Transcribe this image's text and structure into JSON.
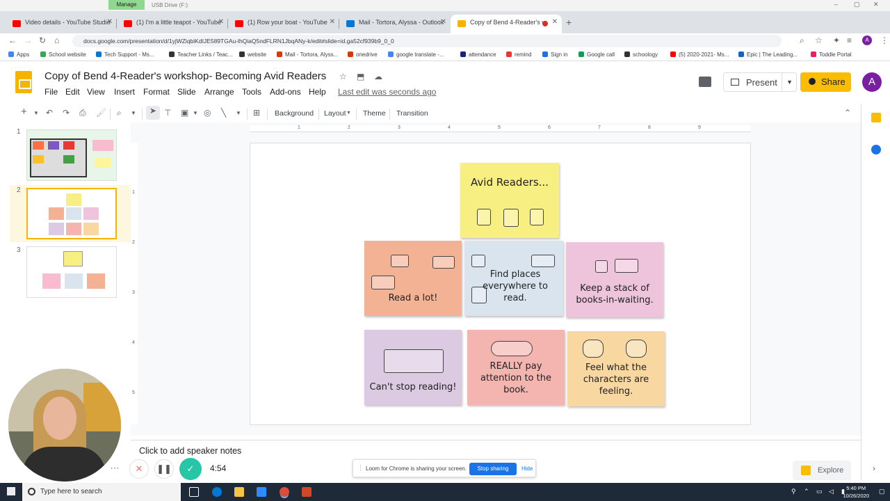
{
  "window": {
    "manage_label": "Manage",
    "drive_label": "USB Drive (F:)"
  },
  "tabs": [
    {
      "title": "Video details - YouTube Studio",
      "color": "#ff0000"
    },
    {
      "title": "(1) I'm a little teapot - YouTube",
      "color": "#ff0000"
    },
    {
      "title": "(1) Row your boat - YouTube",
      "color": "#ff0000"
    },
    {
      "title": "Mail - Tortora, Alyssa - Outlook",
      "color": "#0078d4"
    },
    {
      "title": "Copy of Bend 4-Reader's w",
      "color": "#f4b400"
    }
  ],
  "browser": {
    "url": "docs.google.com/presentation/d/1yjWZiqbiKdIJE589TGAu-lhQiaQ5ndFLRN1JbqANy-k/edit#slide=id.ga52cf939b9_0_0"
  },
  "bookmarks": [
    {
      "label": "Apps",
      "color": "#4285f4"
    },
    {
      "label": "School website",
      "color": "#34a853"
    },
    {
      "label": "Tech Support - Ms...",
      "color": "#0078d4"
    },
    {
      "label": "Teacher Links / Teac...",
      "color": "#333"
    },
    {
      "label": "website",
      "color": "#333"
    },
    {
      "label": "Mail - Tortora, Alyss...",
      "color": "#d83b01"
    },
    {
      "label": "onedrive",
      "color": "#d83b01"
    },
    {
      "label": "google translate -...",
      "color": "#4285f4"
    },
    {
      "label": "attendance",
      "color": "#1a237e"
    },
    {
      "label": "remind",
      "color": "#e53935"
    },
    {
      "label": "Sign in",
      "color": "#1a73e8"
    },
    {
      "label": "Google call",
      "color": "#0f9d58"
    },
    {
      "label": "schoology",
      "color": "#333"
    },
    {
      "label": "(5) 2020-2021- Ms...",
      "color": "#ff0000"
    },
    {
      "label": "Epic | The Leading...",
      "color": "#1565c0"
    },
    {
      "label": "Toddle Portal",
      "color": "#e91e63"
    }
  ],
  "doc": {
    "title": "Copy of Bend 4-Reader's workshop- Becoming Avid Readers",
    "last_edit": "Last edit was seconds ago",
    "menus": [
      "File",
      "Edit",
      "View",
      "Insert",
      "Format",
      "Slide",
      "Arrange",
      "Tools",
      "Add-ons",
      "Help"
    ],
    "present_label": "Present",
    "share_label": "Share",
    "avatar_letter": "A"
  },
  "toolbar": {
    "background": "Background",
    "layout": "Layout",
    "theme": "Theme",
    "transition": "Transition"
  },
  "ruler_ticks": [
    "1",
    "2",
    "3",
    "4",
    "5",
    "6",
    "7",
    "8",
    "9"
  ],
  "vruler_ticks": [
    "1",
    "2",
    "3",
    "4",
    "5"
  ],
  "filmstrip": {
    "numbers": [
      "1",
      "2",
      "3"
    ]
  },
  "slide": {
    "title_note": "Avid Readers...",
    "notes": [
      {
        "text": "Read a lot!",
        "color": "#f4b294"
      },
      {
        "text": "Find places everywhere to read.",
        "color": "#d9e4ee"
      },
      {
        "text": "Keep a stack of books-in-waiting.",
        "color": "#eec3dc"
      },
      {
        "text": "Can't stop reading!",
        "color": "#dcc9e2"
      },
      {
        "text": "REALLY pay attention to the book.",
        "color": "#f4b4b0"
      },
      {
        "text": "Feel what the characters are feeling.",
        "color": "#f8d7a0"
      }
    ],
    "title_color": "#f7ef82"
  },
  "speaker_notes": {
    "placeholder": "Click to add speaker notes"
  },
  "loom": {
    "message": "Loom for Chrome is sharing your screen.",
    "stop": "Stop sharing",
    "hide": "Hide"
  },
  "explore": {
    "label": "Explore"
  },
  "recorder": {
    "time": "4:54"
  },
  "taskbar": {
    "search_placeholder": "Type here to search",
    "time": "5:40 PM",
    "date": "10/26/2020"
  }
}
